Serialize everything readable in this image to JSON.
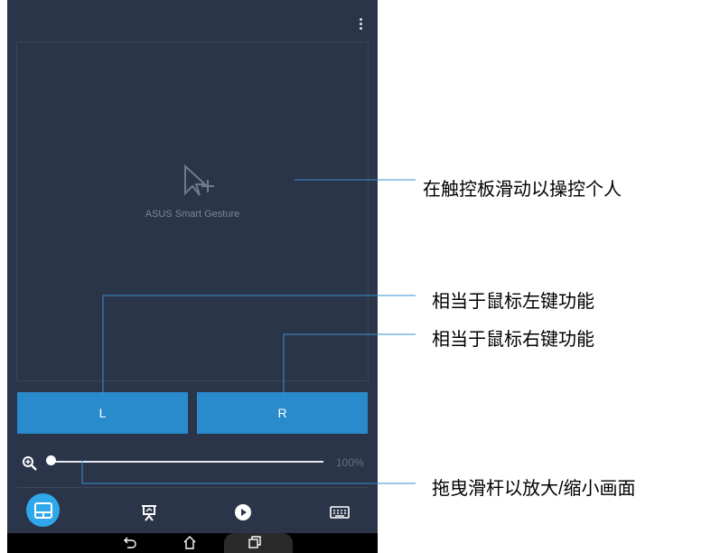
{
  "app": {
    "touchpad_label": "ASUS Smart Gesture",
    "left_button_label": "L",
    "right_button_label": "R",
    "zoom_value": "100%",
    "zoom_level_fraction": 0.0
  },
  "tabs": [
    {
      "icon": "touchpad-icon",
      "selected": true
    },
    {
      "icon": "presentation-icon",
      "selected": false
    },
    {
      "icon": "play-icon",
      "selected": false
    },
    {
      "icon": "keyboard-icon",
      "selected": false
    }
  ],
  "navbar": [
    "back-icon",
    "home-icon",
    "recent-apps-icon"
  ],
  "callouts": {
    "touchpad": "在触控板滑动以操控个人",
    "left_click": "相当于鼠标左键功能",
    "right_click": "相当于鼠标右键功能",
    "zoom": "拖曳滑杆以放大/缩小画面"
  },
  "colors": {
    "panel": "#2b3549",
    "button": "#2a8bcc",
    "accent": "#2ea8ea",
    "leader": "#3a8fd0"
  }
}
